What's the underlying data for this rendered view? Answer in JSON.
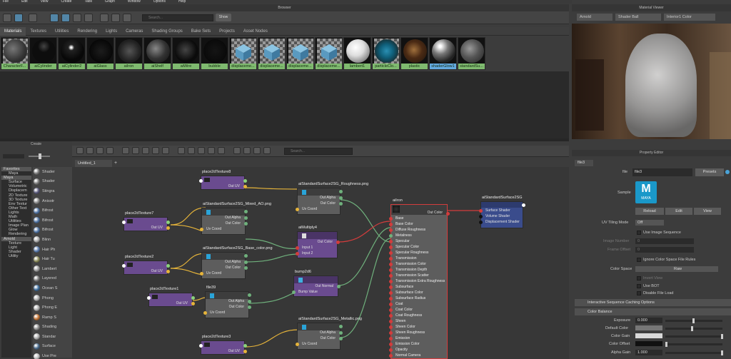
{
  "menu": [
    "File",
    "Edit",
    "View",
    "Create",
    "Tabs",
    "Graph",
    "Window",
    "Options",
    "Help"
  ],
  "browser": {
    "title": "Browser",
    "search_placeholder": "Search...",
    "show_label": "Show",
    "tabs": [
      "Materials",
      "Textures",
      "Utilities",
      "Rendering",
      "Lights",
      "Cameras",
      "Shading Groups",
      "Bake Sets",
      "Projects",
      "Asset Nodes"
    ],
    "active_tab": "Materials",
    "materials": [
      "CharacterF...",
      "aiCylinder",
      "aiCylinder2",
      "aiGlass",
      "aiIron",
      "aiShelf",
      "aiWire",
      "bubble",
      "displaceme...",
      "displaceme...",
      "displaceme...",
      "displaceme...",
      "lambert1",
      "particleClo...",
      "plastic",
      "shaderGlow1",
      "standardSu..."
    ]
  },
  "create_panel": {
    "title": "Create",
    "tree": [
      {
        "label": "Favorites",
        "type": "cat"
      },
      {
        "label": "Maya",
        "type": "item"
      },
      {
        "label": "Maya",
        "type": "cat"
      },
      {
        "label": "Surface",
        "type": "item"
      },
      {
        "label": "Volumetric",
        "type": "item"
      },
      {
        "label": "Displacem",
        "type": "item"
      },
      {
        "label": "2D Texture",
        "type": "item"
      },
      {
        "label": "3D Texture",
        "type": "item"
      },
      {
        "label": "Env Textur",
        "type": "item"
      },
      {
        "label": "Other Text",
        "type": "item"
      },
      {
        "label": "Lights",
        "type": "item"
      },
      {
        "label": "Math",
        "type": "item"
      },
      {
        "label": "Utilities",
        "type": "item"
      },
      {
        "label": "Image Plan",
        "type": "item"
      },
      {
        "label": "Glow",
        "type": "item"
      },
      {
        "label": "Rendering",
        "type": "item"
      },
      {
        "label": "Arnold",
        "type": "cat"
      },
      {
        "label": "Texture",
        "type": "item"
      },
      {
        "label": "Light",
        "type": "item"
      },
      {
        "label": "Shader",
        "type": "item"
      },
      {
        "label": "Utility",
        "type": "item"
      }
    ],
    "shaders": [
      "Shader",
      "Shader",
      "Stingra",
      "Anisotr",
      "Bifrost",
      "Bifrost",
      "Bifrost",
      "Blinn",
      "Hair Ph",
      "Hair Tu",
      "Lambert",
      "Layered",
      "Ocean S",
      "Phong",
      "Phong E",
      "Ramp S",
      "Shading",
      "Standar",
      "Surface",
      "Use Pre"
    ]
  },
  "node_editor": {
    "search_placeholder": "Search...",
    "tab_label": "Untitled_1",
    "nodes": {
      "p2d8": {
        "title": "place2dTexture8",
        "out": "Out UV"
      },
      "p2d7": {
        "title": "place2dTexture7",
        "out": "Out UV"
      },
      "p2d2": {
        "title": "place2dTexture2",
        "out": "Out UV"
      },
      "p2d1": {
        "title": "place2dTexture1",
        "out": "Out UV"
      },
      "p2d3": {
        "title": "place2dTexture3",
        "out": "Out UV"
      },
      "mixed": {
        "title": "aiStandardSurface2SG_Mixed_AO.png",
        "rows": [
          "Out Alpha",
          "Out Color",
          "Uv Coord"
        ]
      },
      "base": {
        "title": "aiStandardSurface2SG_Base_color.png",
        "rows": [
          "Out Alpha",
          "Out Color",
          "Uv Coord"
        ]
      },
      "file39": {
        "title": "file39",
        "rows": [
          "Out Alpha",
          "Out Color",
          "Uv Coord"
        ]
      },
      "rough": {
        "title": "aiStandardSurface2SG_Roughness.png",
        "rows": [
          "Out Alpha",
          "Out Color",
          "Uv Coord"
        ]
      },
      "mult": {
        "title": "aiMultiply4",
        "rows": [
          "Out Color",
          "Input 1",
          "Input 2"
        ]
      },
      "bump": {
        "title": "bump2d6",
        "rows": [
          "Out Normal",
          "Bump Value"
        ]
      },
      "metal": {
        "title": "aiStandardSurface2SG_Metallic.png",
        "rows": [
          "Out Alpha",
          "Out Color",
          "Uv Coord"
        ]
      },
      "aiiron": {
        "title": "aiIron",
        "out": "Out Color",
        "rows": [
          "Base",
          "Base Color",
          "Diffuse Roughness",
          "Metalness",
          "Specular",
          "Specular Color",
          "Specular Roughness",
          "Transmission",
          "Transmission Color",
          "Transmission Depth",
          "Transmission Scatter",
          "Transmission Extra Roughness",
          "Subsurface",
          "Subsurface Color",
          "Subsurface Radius",
          "Coat",
          "Coat Color",
          "Coat Roughness",
          "Sheen",
          "Sheen Color",
          "Sheen Roughness",
          "Emission",
          "Emission Color",
          "Opacity",
          "Normal Camera"
        ]
      },
      "sg": {
        "title": "aiStandardSurface2SG",
        "rows": [
          "Surface Shader",
          "Volume Shader",
          "Displacement Shader"
        ]
      }
    }
  },
  "viewer": {
    "title": "Material Viewer",
    "renderer": "Arnold",
    "mode": "Shader Ball",
    "env": "Interior1 Color"
  },
  "property_editor": {
    "title": "Property Editor",
    "tab": "file3",
    "file_label": "file",
    "file_value": "file3",
    "presets_label": "Presets",
    "sample_label": "Sample",
    "maya_logo": "MAYA",
    "buttons": [
      "Reload",
      "Edit",
      "View"
    ],
    "uv_tiling_label": "UV Tiling Mode",
    "uv_tiling_value": "Off",
    "use_image_sequence": "Use Image Sequence",
    "image_number": "Image Number",
    "image_number_value": "0",
    "frame_offset": "Frame Offset",
    "frame_offset_value": "0",
    "ignore_cs": "Ignore Color Space File Rules",
    "color_space_label": "Color Space",
    "color_space_value": "Raw",
    "invert_view": "Invert View",
    "use_bot": "Use BOT",
    "disable_file_load": "Disable File Load",
    "section1": "Interactive Sequence Caching Options",
    "section2": "Color Balance",
    "exposure_label": "Exposure",
    "exposure_value": "0.000",
    "default_color": "Default Color",
    "color_gain": "Color Gain",
    "color_offset": "Color Offset",
    "alpha_gain": "Alpha Gain",
    "alpha_gain_value": "1.000"
  },
  "colors": {
    "material_label": "#7fba6f",
    "selected_label": "#63a9de",
    "node_purple": "#6a4b8f",
    "node_gray": "#5d5d5d",
    "wire_yellow": "#e6b43a",
    "wire_green": "#6fb07c",
    "wire_red": "#d33c3c",
    "sg_blue": "#3a4c8c"
  }
}
